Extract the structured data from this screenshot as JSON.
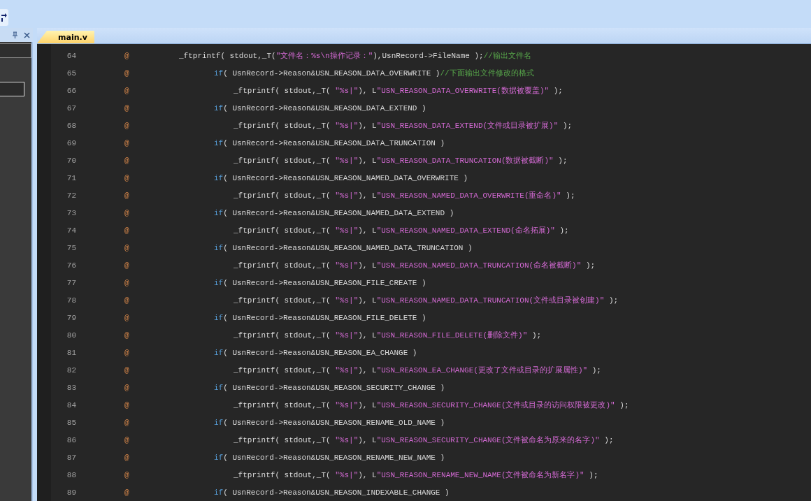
{
  "panel": {
    "fields": [
      {
        "kind": "filled"
      },
      {
        "kind": "outlined"
      }
    ]
  },
  "tabs": [
    {
      "label": "main.v",
      "selected": true
    }
  ],
  "lines": [
    {
      "number": "64",
      "marker": "@",
      "kind": "top",
      "tokens": [
        {
          "kind": "plain",
          "text": "_ftprintf( stdout,_T("
        },
        {
          "kind": "string",
          "text": "\"文件名：%s\\n操作记录：\""
        },
        {
          "kind": "plain",
          "text": "),UsnRecord->FileName );"
        },
        {
          "kind": "comment",
          "text": "//输出文件名"
        }
      ]
    },
    {
      "number": "65",
      "marker": "@",
      "kind": "cond",
      "tokens": [
        {
          "kind": "keyword",
          "text": "if"
        },
        {
          "kind": "plain",
          "text": "( UsnRecord->Reason&USN_REASON_DATA_OVERWRITE )"
        },
        {
          "kind": "comment",
          "text": "//下面输出文件修改的格式"
        }
      ]
    },
    {
      "number": "66",
      "marker": "@",
      "kind": "body",
      "tokens": [
        {
          "kind": "plain",
          "text": "_ftprintf( stdout,_T( "
        },
        {
          "kind": "string",
          "text": "\"%s|\""
        },
        {
          "kind": "plain",
          "text": "), L"
        },
        {
          "kind": "string",
          "text": "\"USN_REASON_DATA_OVERWRITE(数据被覆盖)\""
        },
        {
          "kind": "plain",
          "text": " );"
        }
      ]
    },
    {
      "number": "67",
      "marker": "@",
      "kind": "cond",
      "tokens": [
        {
          "kind": "keyword",
          "text": "if"
        },
        {
          "kind": "plain",
          "text": "( UsnRecord->Reason&USN_REASON_DATA_EXTEND )"
        }
      ]
    },
    {
      "number": "68",
      "marker": "@",
      "kind": "body",
      "tokens": [
        {
          "kind": "plain",
          "text": "_ftprintf( stdout,_T( "
        },
        {
          "kind": "string",
          "text": "\"%s|\""
        },
        {
          "kind": "plain",
          "text": "), L"
        },
        {
          "kind": "string",
          "text": "\"USN_REASON_DATA_EXTEND(文件或目录被扩展)\""
        },
        {
          "kind": "plain",
          "text": " );"
        }
      ]
    },
    {
      "number": "69",
      "marker": "@",
      "kind": "cond",
      "tokens": [
        {
          "kind": "keyword",
          "text": "if"
        },
        {
          "kind": "plain",
          "text": "( UsnRecord->Reason&USN_REASON_DATA_TRUNCATION )"
        }
      ]
    },
    {
      "number": "70",
      "marker": "@",
      "kind": "body",
      "tokens": [
        {
          "kind": "plain",
          "text": "_ftprintf( stdout,_T( "
        },
        {
          "kind": "string",
          "text": "\"%s|\""
        },
        {
          "kind": "plain",
          "text": "), L"
        },
        {
          "kind": "string",
          "text": "\"USN_REASON_DATA_TRUNCATION(数据被截断)\""
        },
        {
          "kind": "plain",
          "text": " );"
        }
      ]
    },
    {
      "number": "71",
      "marker": "@",
      "kind": "cond",
      "tokens": [
        {
          "kind": "keyword",
          "text": "if"
        },
        {
          "kind": "plain",
          "text": "( UsnRecord->Reason&USN_REASON_NAMED_DATA_OVERWRITE )"
        }
      ]
    },
    {
      "number": "72",
      "marker": "@",
      "kind": "body",
      "tokens": [
        {
          "kind": "plain",
          "text": "_ftprintf( stdout,_T( "
        },
        {
          "kind": "string",
          "text": "\"%s|\""
        },
        {
          "kind": "plain",
          "text": "), L"
        },
        {
          "kind": "string",
          "text": "\"USN_REASON_NAMED_DATA_OVERWRITE(重命名)\""
        },
        {
          "kind": "plain",
          "text": " );"
        }
      ]
    },
    {
      "number": "73",
      "marker": "@",
      "kind": "cond",
      "tokens": [
        {
          "kind": "keyword",
          "text": "if"
        },
        {
          "kind": "plain",
          "text": "( UsnRecord->Reason&USN_REASON_NAMED_DATA_EXTEND )"
        }
      ]
    },
    {
      "number": "74",
      "marker": "@",
      "kind": "body",
      "tokens": [
        {
          "kind": "plain",
          "text": "_ftprintf( stdout,_T( "
        },
        {
          "kind": "string",
          "text": "\"%s|\""
        },
        {
          "kind": "plain",
          "text": "), L"
        },
        {
          "kind": "string",
          "text": "\"USN_REASON_NAMED_DATA_EXTEND(命名拓展)\""
        },
        {
          "kind": "plain",
          "text": " );"
        }
      ]
    },
    {
      "number": "75",
      "marker": "@",
      "kind": "cond",
      "tokens": [
        {
          "kind": "keyword",
          "text": "if"
        },
        {
          "kind": "plain",
          "text": "( UsnRecord->Reason&USN_REASON_NAMED_DATA_TRUNCATION )"
        }
      ]
    },
    {
      "number": "76",
      "marker": "@",
      "kind": "body",
      "tokens": [
        {
          "kind": "plain",
          "text": "_ftprintf( stdout,_T( "
        },
        {
          "kind": "string",
          "text": "\"%s|\""
        },
        {
          "kind": "plain",
          "text": "), L"
        },
        {
          "kind": "string",
          "text": "\"USN_REASON_NAMED_DATA_TRUNCATION(命名被截断)\""
        },
        {
          "kind": "plain",
          "text": " );"
        }
      ]
    },
    {
      "number": "77",
      "marker": "@",
      "kind": "cond",
      "tokens": [
        {
          "kind": "keyword",
          "text": "if"
        },
        {
          "kind": "plain",
          "text": "( UsnRecord->Reason&USN_REASON_FILE_CREATE )"
        }
      ]
    },
    {
      "number": "78",
      "marker": "@",
      "kind": "body",
      "tokens": [
        {
          "kind": "plain",
          "text": "_ftprintf( stdout,_T( "
        },
        {
          "kind": "string",
          "text": "\"%s|\""
        },
        {
          "kind": "plain",
          "text": "), L"
        },
        {
          "kind": "string",
          "text": "\"USN_REASON_NAMED_DATA_TRUNCATION(文件或目录被创建)\""
        },
        {
          "kind": "plain",
          "text": " );"
        }
      ]
    },
    {
      "number": "79",
      "marker": "@",
      "kind": "cond",
      "tokens": [
        {
          "kind": "keyword",
          "text": "if"
        },
        {
          "kind": "plain",
          "text": "( UsnRecord->Reason&USN_REASON_FILE_DELETE )"
        }
      ]
    },
    {
      "number": "80",
      "marker": "@",
      "kind": "body",
      "tokens": [
        {
          "kind": "plain",
          "text": "_ftprintf( stdout,_T( "
        },
        {
          "kind": "string",
          "text": "\"%s|\""
        },
        {
          "kind": "plain",
          "text": "), L"
        },
        {
          "kind": "string",
          "text": "\"USN_REASON_FILE_DELETE(删除文件)\""
        },
        {
          "kind": "plain",
          "text": " );"
        }
      ]
    },
    {
      "number": "81",
      "marker": "@",
      "kind": "cond",
      "tokens": [
        {
          "kind": "keyword",
          "text": "if"
        },
        {
          "kind": "plain",
          "text": "( UsnRecord->Reason&USN_REASON_EA_CHANGE )"
        }
      ]
    },
    {
      "number": "82",
      "marker": "@",
      "kind": "body",
      "tokens": [
        {
          "kind": "plain",
          "text": "_ftprintf( stdout,_T( "
        },
        {
          "kind": "string",
          "text": "\"%s|\""
        },
        {
          "kind": "plain",
          "text": "), L"
        },
        {
          "kind": "string",
          "text": "\"USN_REASON_EA_CHANGE(更改了文件或目录的扩展属性)\""
        },
        {
          "kind": "plain",
          "text": " );"
        }
      ]
    },
    {
      "number": "83",
      "marker": "@",
      "kind": "cond",
      "tokens": [
        {
          "kind": "keyword",
          "text": "if"
        },
        {
          "kind": "plain",
          "text": "( UsnRecord->Reason&USN_REASON_SECURITY_CHANGE )"
        }
      ]
    },
    {
      "number": "84",
      "marker": "@",
      "kind": "body",
      "tokens": [
        {
          "kind": "plain",
          "text": "_ftprintf( stdout,_T( "
        },
        {
          "kind": "string",
          "text": "\"%s|\""
        },
        {
          "kind": "plain",
          "text": "), L"
        },
        {
          "kind": "string",
          "text": "\"USN_REASON_SECURITY_CHANGE(文件或目录的访问权限被更改)\""
        },
        {
          "kind": "plain",
          "text": " );"
        }
      ]
    },
    {
      "number": "85",
      "marker": "@",
      "kind": "cond",
      "tokens": [
        {
          "kind": "keyword",
          "text": "if"
        },
        {
          "kind": "plain",
          "text": "( UsnRecord->Reason&USN_REASON_RENAME_OLD_NAME )"
        }
      ]
    },
    {
      "number": "86",
      "marker": "@",
      "kind": "body",
      "tokens": [
        {
          "kind": "plain",
          "text": "_ftprintf( stdout,_T( "
        },
        {
          "kind": "string",
          "text": "\"%s|\""
        },
        {
          "kind": "plain",
          "text": "), L"
        },
        {
          "kind": "string",
          "text": "\"USN_REASON_SECURITY_CHANGE(文件被命名为原来的名字)\""
        },
        {
          "kind": "plain",
          "text": " );"
        }
      ]
    },
    {
      "number": "87",
      "marker": "@",
      "kind": "cond",
      "tokens": [
        {
          "kind": "keyword",
          "text": "if"
        },
        {
          "kind": "plain",
          "text": "( UsnRecord->Reason&USN_REASON_RENAME_NEW_NAME )"
        }
      ]
    },
    {
      "number": "88",
      "marker": "@",
      "kind": "body",
      "tokens": [
        {
          "kind": "plain",
          "text": "_ftprintf( stdout,_T( "
        },
        {
          "kind": "string",
          "text": "\"%s|\""
        },
        {
          "kind": "plain",
          "text": "), L"
        },
        {
          "kind": "string",
          "text": "\"USN_REASON_RENAME_NEW_NAME(文件被命名为新名字)\""
        },
        {
          "kind": "plain",
          "text": " );"
        }
      ]
    },
    {
      "number": "89",
      "marker": "@",
      "kind": "cond",
      "tokens": [
        {
          "kind": "keyword",
          "text": "if"
        },
        {
          "kind": "plain",
          "text": "( UsnRecord->Reason&USN_REASON_INDEXABLE_CHANGE )"
        }
      ]
    }
  ]
}
